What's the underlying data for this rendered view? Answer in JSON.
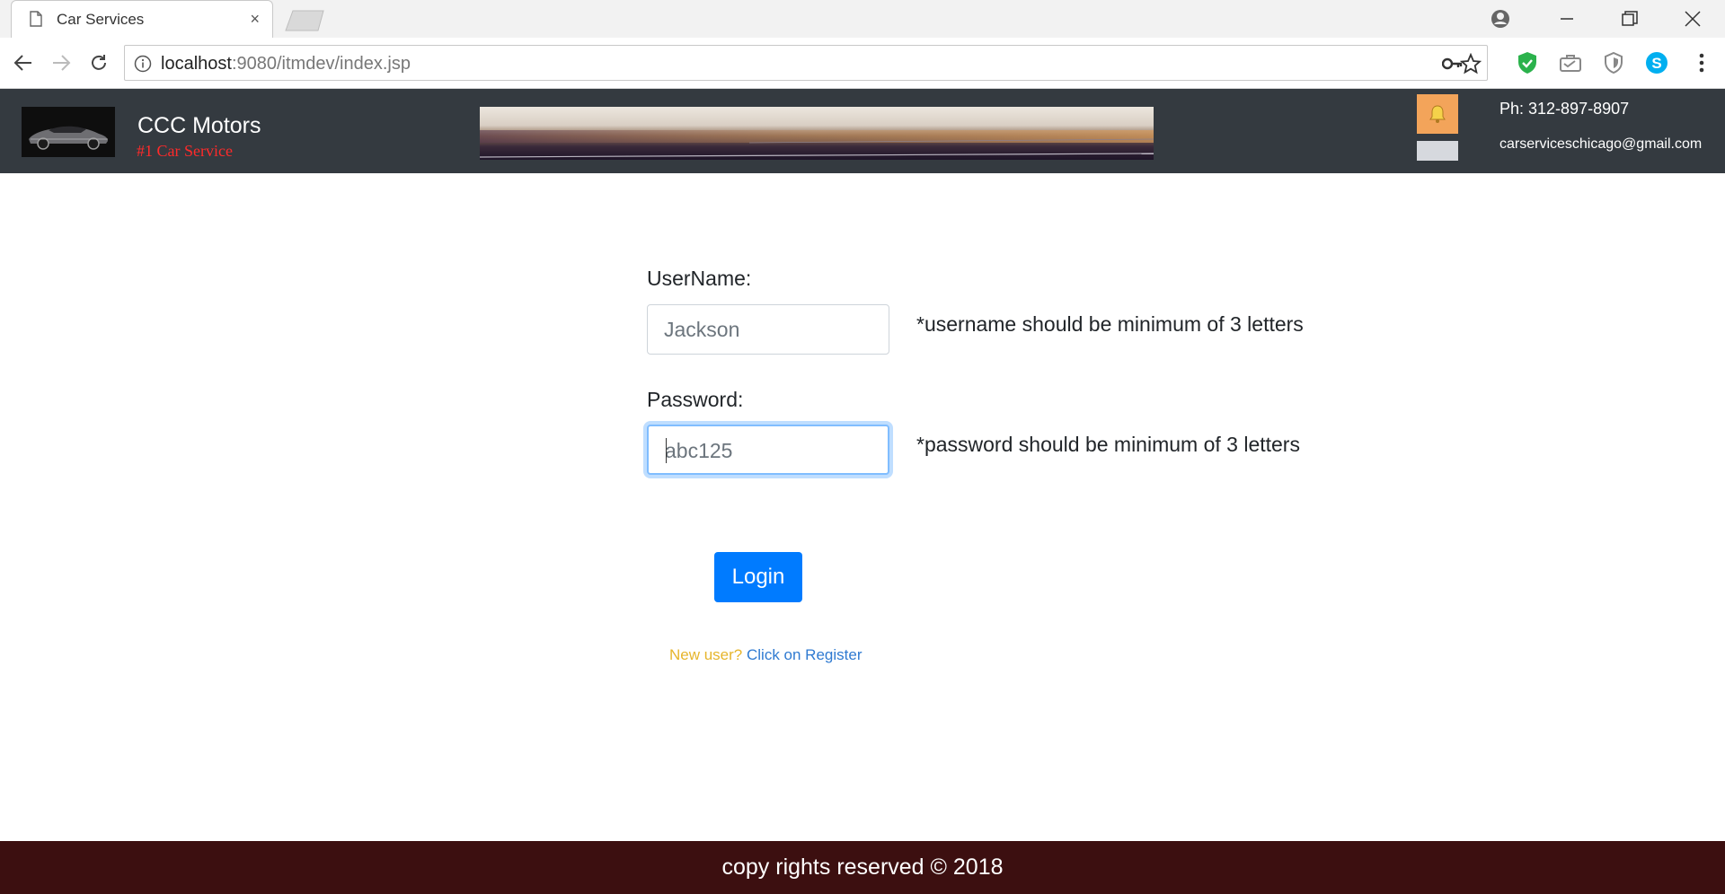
{
  "browser": {
    "tab_title": "Car Services",
    "tab_close": "×",
    "url_host": "localhost",
    "url_rest": ":9080/itmdev/index.jsp"
  },
  "header": {
    "brand": "CCC Motors",
    "tagline": "#1 Car Service",
    "phone": "Ph: 312-897-8907",
    "email": "carserviceschicago@gmail.com"
  },
  "form": {
    "username_label": "UserName:",
    "username_value": "Jackson",
    "username_hint": "*username should be minimum of 3 letters",
    "password_label": "Password:",
    "password_value": "abc125",
    "password_hint": "*password should be minimum of 3 letters",
    "login_label": "Login",
    "new_user_text": "New user?",
    "register_link": "Click on Register"
  },
  "footer": {
    "copyright": "copy rights reserved © 2018"
  },
  "colors": {
    "header_bg": "#343a40",
    "tagline": "#ff2a2a",
    "button": "#007bff",
    "footer_bg": "#3c0f10",
    "new_user": "#e6b52c",
    "link": "#2f7ad1"
  },
  "icons": [
    "page-icon",
    "close-icon",
    "minimize-icon",
    "restore-icon",
    "window-close-icon",
    "back-icon",
    "forward-icon",
    "reload-icon",
    "info-icon",
    "key-icon",
    "star-icon",
    "shield-check-icon",
    "briefcase-icon",
    "shield-icon",
    "skype-icon",
    "menu-dots-icon",
    "profile-icon",
    "bell-icon"
  ]
}
